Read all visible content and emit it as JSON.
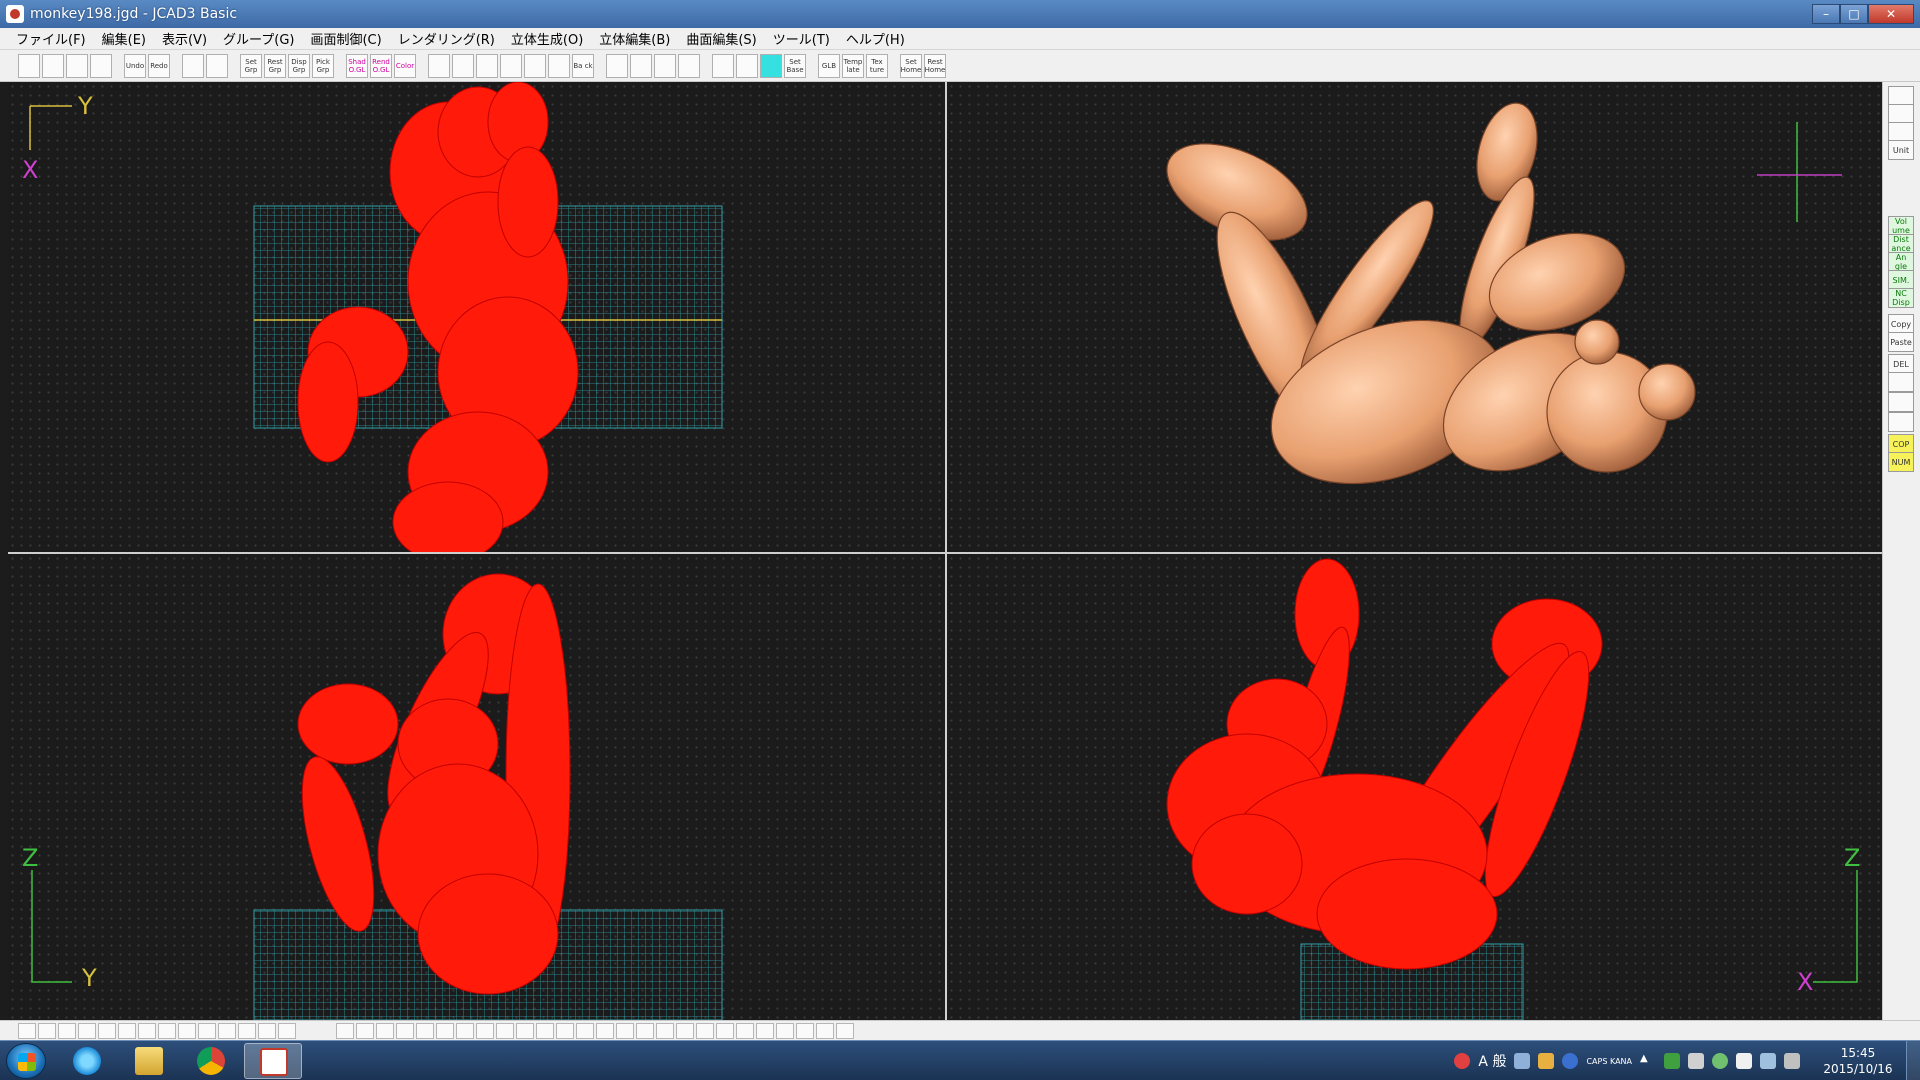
{
  "window": {
    "title": "monkey198.jgd - JCAD3 Basic",
    "controls": {
      "minimize": "–",
      "maximize": "□",
      "close": "✕"
    }
  },
  "menu": [
    "ファイル(F)",
    "編集(E)",
    "表示(V)",
    "グループ(G)",
    "画面制御(C)",
    "レンダリング(R)",
    "立体生成(O)",
    "立体編集(B)",
    "曲面編集(S)",
    "ツール(T)",
    "ヘルプ(H)"
  ],
  "toolbar": [
    {
      "label": "",
      "icon": "new-file-icon"
    },
    {
      "label": "",
      "icon": "open-folder-icon"
    },
    {
      "label": "",
      "icon": "save-icon"
    },
    {
      "label": "",
      "icon": "print-icon"
    },
    {
      "label": "Undo",
      "icon": "undo-icon"
    },
    {
      "label": "Redo",
      "icon": "redo-icon"
    },
    {
      "label": "",
      "icon": "view-quad-icon"
    },
    {
      "label": "",
      "icon": "view-grid-icon"
    },
    {
      "label": "Set Grp",
      "icon": "set-group-icon"
    },
    {
      "label": "Rest Grp",
      "icon": "rest-group-icon"
    },
    {
      "label": "Disp Grp",
      "icon": "display-group-icon"
    },
    {
      "label": "Pick Grp",
      "icon": "pick-group-icon"
    },
    {
      "label": "Shad O.GL",
      "icon": "shade-opengl-icon"
    },
    {
      "label": "Rend O.GL",
      "icon": "render-opengl-icon"
    },
    {
      "label": "Color",
      "icon": "color-icon"
    },
    {
      "label": "",
      "icon": "zoom-in-icon"
    },
    {
      "label": "",
      "icon": "zoom-out-icon"
    },
    {
      "label": "",
      "icon": "zoom-fit-icon"
    },
    {
      "label": "",
      "icon": "zoom-window-icon"
    },
    {
      "label": "",
      "icon": "zoom-all-icon"
    },
    {
      "label": "",
      "icon": "pan-hand-icon"
    },
    {
      "label": "Ba ck",
      "icon": "back-view-icon"
    },
    {
      "label": "",
      "icon": "zoom-red-in-icon"
    },
    {
      "label": "",
      "icon": "zoom-red-out-icon"
    },
    {
      "label": "",
      "icon": "magnify-icon"
    },
    {
      "label": "",
      "icon": "frame-icon"
    },
    {
      "label": "",
      "icon": "grid-dots-icon"
    },
    {
      "label": "",
      "icon": "grid-fine-icon"
    },
    {
      "label": "",
      "icon": "grid-active-icon"
    },
    {
      "label": "Set Base",
      "icon": "set-base-icon"
    },
    {
      "label": "GLB",
      "icon": "global-icon"
    },
    {
      "label": "Temp late",
      "icon": "template-icon"
    },
    {
      "label": "Tex ture",
      "icon": "texture-icon"
    },
    {
      "label": "Set Home",
      "icon": "set-home-icon"
    },
    {
      "label": "Rest Home",
      "icon": "rest-home-icon"
    }
  ],
  "viewports": [
    {
      "id": "top-view",
      "axes": [
        "Y",
        "X"
      ],
      "mode": "wireframe"
    },
    {
      "id": "perspective-view",
      "axes": [],
      "mode": "shaded"
    },
    {
      "id": "front-view",
      "axes": [
        "Z",
        "Y"
      ],
      "mode": "wireframe"
    },
    {
      "id": "side-view",
      "axes": [
        "Z",
        "X"
      ],
      "mode": "wireframe"
    }
  ],
  "sidebar": [
    {
      "label": "",
      "icon": "eye-icon"
    },
    {
      "label": "",
      "icon": "camera-icon"
    },
    {
      "label": "",
      "icon": "layers-icon"
    },
    {
      "label": "Unit",
      "icon": "unit-icon"
    },
    {
      "label": "Vol ume",
      "icon": "volume-icon",
      "style": "green"
    },
    {
      "label": "Dist ance",
      "icon": "distance-icon",
      "style": "green"
    },
    {
      "label": "An gle",
      "icon": "angle-icon",
      "style": "green"
    },
    {
      "label": "SIM.",
      "icon": "sim-icon",
      "style": "green"
    },
    {
      "label": "NC Disp",
      "icon": "nc-display-icon",
      "style": "green"
    },
    {
      "label": "Copy",
      "icon": "copy-icon"
    },
    {
      "label": "Paste",
      "icon": "paste-icon"
    },
    {
      "label": "DEL",
      "icon": "delete-icon"
    },
    {
      "label": "",
      "icon": "list-icon"
    },
    {
      "label": "",
      "icon": "tree-icon"
    },
    {
      "label": "",
      "icon": "properties-icon"
    },
    {
      "label": "COP",
      "icon": "cop-icon",
      "style": "yellow"
    },
    {
      "label": "NUM",
      "icon": "num-icon",
      "style": "yellow"
    }
  ],
  "taskbar": {
    "apps": [
      "internet-explorer-icon",
      "file-explorer-icon",
      "chrome-icon",
      "jcad3-icon"
    ],
    "tray": {
      "ime": "A 般",
      "caps": "CAPS KANA"
    },
    "clock": {
      "time": "15:45",
      "date": "2015/10/16"
    }
  },
  "colors": {
    "viewport_bg": "#1b1b1b",
    "wire": "#ff1a0a",
    "base_grid": "#2fa0a8",
    "axis_yellow": "#d8c040",
    "skin": "#e8a070"
  }
}
